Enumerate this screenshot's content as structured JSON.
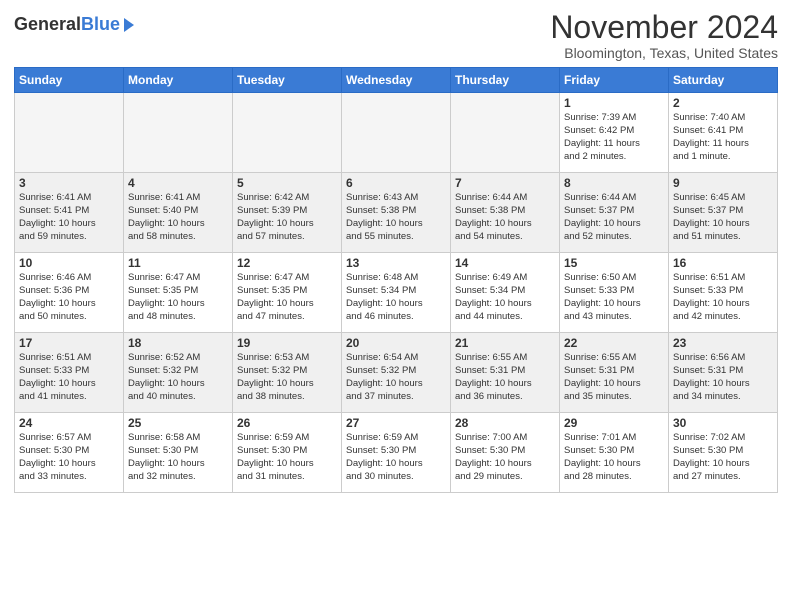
{
  "header": {
    "logo_general": "General",
    "logo_blue": "Blue",
    "month": "November 2024",
    "location": "Bloomington, Texas, United States"
  },
  "days_of_week": [
    "Sunday",
    "Monday",
    "Tuesday",
    "Wednesday",
    "Thursday",
    "Friday",
    "Saturday"
  ],
  "weeks": [
    [
      {
        "day": "",
        "info": ""
      },
      {
        "day": "",
        "info": ""
      },
      {
        "day": "",
        "info": ""
      },
      {
        "day": "",
        "info": ""
      },
      {
        "day": "",
        "info": ""
      },
      {
        "day": "1",
        "info": "Sunrise: 7:39 AM\nSunset: 6:42 PM\nDaylight: 11 hours\nand 2 minutes."
      },
      {
        "day": "2",
        "info": "Sunrise: 7:40 AM\nSunset: 6:41 PM\nDaylight: 11 hours\nand 1 minute."
      }
    ],
    [
      {
        "day": "3",
        "info": "Sunrise: 6:41 AM\nSunset: 5:41 PM\nDaylight: 10 hours\nand 59 minutes."
      },
      {
        "day": "4",
        "info": "Sunrise: 6:41 AM\nSunset: 5:40 PM\nDaylight: 10 hours\nand 58 minutes."
      },
      {
        "day": "5",
        "info": "Sunrise: 6:42 AM\nSunset: 5:39 PM\nDaylight: 10 hours\nand 57 minutes."
      },
      {
        "day": "6",
        "info": "Sunrise: 6:43 AM\nSunset: 5:38 PM\nDaylight: 10 hours\nand 55 minutes."
      },
      {
        "day": "7",
        "info": "Sunrise: 6:44 AM\nSunset: 5:38 PM\nDaylight: 10 hours\nand 54 minutes."
      },
      {
        "day": "8",
        "info": "Sunrise: 6:44 AM\nSunset: 5:37 PM\nDaylight: 10 hours\nand 52 minutes."
      },
      {
        "day": "9",
        "info": "Sunrise: 6:45 AM\nSunset: 5:37 PM\nDaylight: 10 hours\nand 51 minutes."
      }
    ],
    [
      {
        "day": "10",
        "info": "Sunrise: 6:46 AM\nSunset: 5:36 PM\nDaylight: 10 hours\nand 50 minutes."
      },
      {
        "day": "11",
        "info": "Sunrise: 6:47 AM\nSunset: 5:35 PM\nDaylight: 10 hours\nand 48 minutes."
      },
      {
        "day": "12",
        "info": "Sunrise: 6:47 AM\nSunset: 5:35 PM\nDaylight: 10 hours\nand 47 minutes."
      },
      {
        "day": "13",
        "info": "Sunrise: 6:48 AM\nSunset: 5:34 PM\nDaylight: 10 hours\nand 46 minutes."
      },
      {
        "day": "14",
        "info": "Sunrise: 6:49 AM\nSunset: 5:34 PM\nDaylight: 10 hours\nand 44 minutes."
      },
      {
        "day": "15",
        "info": "Sunrise: 6:50 AM\nSunset: 5:33 PM\nDaylight: 10 hours\nand 43 minutes."
      },
      {
        "day": "16",
        "info": "Sunrise: 6:51 AM\nSunset: 5:33 PM\nDaylight: 10 hours\nand 42 minutes."
      }
    ],
    [
      {
        "day": "17",
        "info": "Sunrise: 6:51 AM\nSunset: 5:33 PM\nDaylight: 10 hours\nand 41 minutes."
      },
      {
        "day": "18",
        "info": "Sunrise: 6:52 AM\nSunset: 5:32 PM\nDaylight: 10 hours\nand 40 minutes."
      },
      {
        "day": "19",
        "info": "Sunrise: 6:53 AM\nSunset: 5:32 PM\nDaylight: 10 hours\nand 38 minutes."
      },
      {
        "day": "20",
        "info": "Sunrise: 6:54 AM\nSunset: 5:32 PM\nDaylight: 10 hours\nand 37 minutes."
      },
      {
        "day": "21",
        "info": "Sunrise: 6:55 AM\nSunset: 5:31 PM\nDaylight: 10 hours\nand 36 minutes."
      },
      {
        "day": "22",
        "info": "Sunrise: 6:55 AM\nSunset: 5:31 PM\nDaylight: 10 hours\nand 35 minutes."
      },
      {
        "day": "23",
        "info": "Sunrise: 6:56 AM\nSunset: 5:31 PM\nDaylight: 10 hours\nand 34 minutes."
      }
    ],
    [
      {
        "day": "24",
        "info": "Sunrise: 6:57 AM\nSunset: 5:30 PM\nDaylight: 10 hours\nand 33 minutes."
      },
      {
        "day": "25",
        "info": "Sunrise: 6:58 AM\nSunset: 5:30 PM\nDaylight: 10 hours\nand 32 minutes."
      },
      {
        "day": "26",
        "info": "Sunrise: 6:59 AM\nSunset: 5:30 PM\nDaylight: 10 hours\nand 31 minutes."
      },
      {
        "day": "27",
        "info": "Sunrise: 6:59 AM\nSunset: 5:30 PM\nDaylight: 10 hours\nand 30 minutes."
      },
      {
        "day": "28",
        "info": "Sunrise: 7:00 AM\nSunset: 5:30 PM\nDaylight: 10 hours\nand 29 minutes."
      },
      {
        "day": "29",
        "info": "Sunrise: 7:01 AM\nSunset: 5:30 PM\nDaylight: 10 hours\nand 28 minutes."
      },
      {
        "day": "30",
        "info": "Sunrise: 7:02 AM\nSunset: 5:30 PM\nDaylight: 10 hours\nand 27 minutes."
      }
    ]
  ]
}
